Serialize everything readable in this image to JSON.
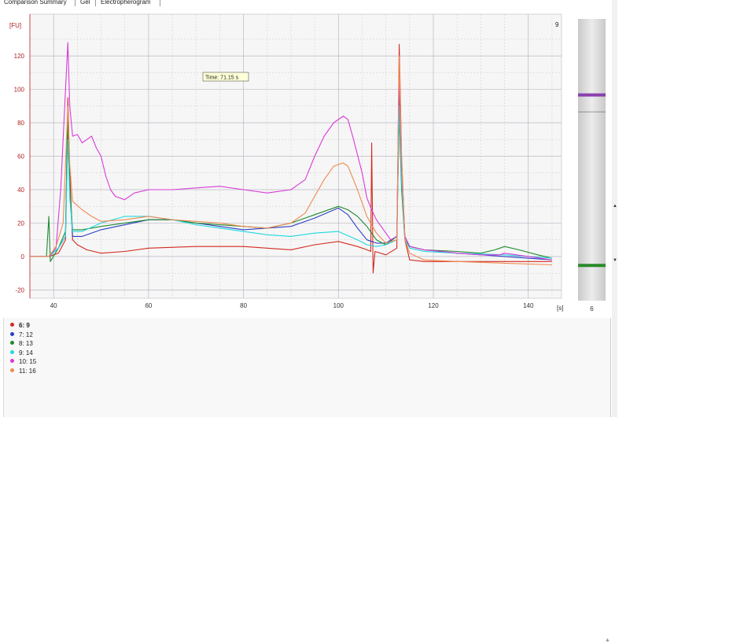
{
  "tabs": [
    "Comparison Summary",
    "Gel",
    "Electropherogram"
  ],
  "chart": {
    "y_unit": "[FU]",
    "x_unit": "[s]",
    "sample_label": "9",
    "tooltip": "Time: 71.15 s"
  },
  "gel": {
    "bottom_label": "6",
    "bands": [
      {
        "position": 0.27,
        "color": "#8a3fb0"
      },
      {
        "position": 0.875,
        "color": "#2a8a2a"
      }
    ],
    "marker_lines": [
      0.33
    ]
  },
  "legend": [
    {
      "label": "6: 9",
      "color": "#d42a20",
      "selected": true
    },
    {
      "label": "7: 12",
      "color": "#2a3fc4",
      "selected": false
    },
    {
      "label": "8: 13",
      "color": "#1f8a30",
      "selected": false
    },
    {
      "label": "9: 14",
      "color": "#20d8e0",
      "selected": false
    },
    {
      "label": "10: 15",
      "color": "#d83ad8",
      "selected": false
    },
    {
      "label": "11: 16",
      "color": "#ef8a50",
      "selected": false
    }
  ],
  "chart_data": {
    "type": "line",
    "xlabel": "[s]",
    "ylabel": "[FU]",
    "xlim": [
      35,
      147
    ],
    "ylim": [
      -25,
      145
    ],
    "xticks": [
      40,
      60,
      80,
      100,
      120,
      140
    ],
    "yticks": [
      -20,
      0,
      20,
      40,
      60,
      80,
      100,
      120
    ],
    "grid": true,
    "legend": "below",
    "series": [
      {
        "name": "6: 9",
        "color": "#d42a20",
        "points": [
          [
            35,
            0
          ],
          [
            39,
            0
          ],
          [
            41,
            2
          ],
          [
            42.5,
            10
          ],
          [
            43,
            95
          ],
          [
            43.4,
            50
          ],
          [
            44,
            10
          ],
          [
            45,
            7
          ],
          [
            47,
            4
          ],
          [
            50,
            2
          ],
          [
            55,
            3
          ],
          [
            60,
            5
          ],
          [
            70,
            6
          ],
          [
            80,
            6
          ],
          [
            85,
            5
          ],
          [
            90,
            4
          ],
          [
            95,
            7
          ],
          [
            100,
            9
          ],
          [
            104,
            6
          ],
          [
            106,
            4
          ],
          [
            106.8,
            3
          ],
          [
            107,
            68
          ],
          [
            107.3,
            -10
          ],
          [
            107.7,
            3
          ],
          [
            110,
            1
          ],
          [
            112.3,
            5
          ],
          [
            112.8,
            127
          ],
          [
            113.3,
            60
          ],
          [
            114,
            10
          ],
          [
            115,
            -2
          ],
          [
            118,
            -3
          ],
          [
            125,
            -3
          ],
          [
            135,
            -3
          ],
          [
            145,
            -3
          ]
        ]
      },
      {
        "name": "7: 12",
        "color": "#2a3fc4",
        "points": [
          [
            35,
            0
          ],
          [
            39,
            0
          ],
          [
            41,
            5
          ],
          [
            42.5,
            12
          ],
          [
            43,
            80
          ],
          [
            43.4,
            40
          ],
          [
            44,
            12
          ],
          [
            46,
            12
          ],
          [
            50,
            16
          ],
          [
            55,
            19
          ],
          [
            60,
            22
          ],
          [
            65,
            22
          ],
          [
            70,
            20
          ],
          [
            75,
            18
          ],
          [
            80,
            16
          ],
          [
            85,
            17
          ],
          [
            90,
            18
          ],
          [
            95,
            23
          ],
          [
            100,
            29
          ],
          [
            102,
            25
          ],
          [
            104,
            17
          ],
          [
            106,
            10
          ],
          [
            108,
            8
          ],
          [
            110,
            8
          ],
          [
            112.3,
            12
          ],
          [
            112.8,
            100
          ],
          [
            113.3,
            50
          ],
          [
            114,
            12
          ],
          [
            115,
            6
          ],
          [
            118,
            4
          ],
          [
            125,
            2
          ],
          [
            135,
            0
          ],
          [
            145,
            -2
          ]
        ]
      },
      {
        "name": "8: 13",
        "color": "#1f8a30",
        "points": [
          [
            35,
            0
          ],
          [
            38.5,
            0
          ],
          [
            39,
            24
          ],
          [
            39.3,
            -3
          ],
          [
            41,
            5
          ],
          [
            42.5,
            15
          ],
          [
            43,
            85
          ],
          [
            43.4,
            40
          ],
          [
            44,
            16
          ],
          [
            46,
            16
          ],
          [
            50,
            18
          ],
          [
            55,
            20
          ],
          [
            60,
            22
          ],
          [
            65,
            22
          ],
          [
            70,
            20
          ],
          [
            75,
            19
          ],
          [
            80,
            18
          ],
          [
            85,
            17
          ],
          [
            90,
            20
          ],
          [
            95,
            25
          ],
          [
            100,
            30
          ],
          [
            102,
            28
          ],
          [
            104,
            24
          ],
          [
            106,
            18
          ],
          [
            108,
            10
          ],
          [
            110,
            7
          ],
          [
            112.3,
            12
          ],
          [
            112.8,
            85
          ],
          [
            113.3,
            40
          ],
          [
            114,
            10
          ],
          [
            115,
            6
          ],
          [
            118,
            4
          ],
          [
            125,
            3
          ],
          [
            130,
            2
          ],
          [
            133,
            4
          ],
          [
            135,
            6
          ],
          [
            138,
            4
          ],
          [
            142,
            1
          ],
          [
            145,
            -1
          ]
        ]
      },
      {
        "name": "9: 14",
        "color": "#20d8e0",
        "points": [
          [
            35,
            0
          ],
          [
            39,
            0
          ],
          [
            41,
            5
          ],
          [
            42.5,
            12
          ],
          [
            43,
            70
          ],
          [
            43.4,
            35
          ],
          [
            44,
            15
          ],
          [
            46,
            15
          ],
          [
            50,
            20
          ],
          [
            55,
            24
          ],
          [
            60,
            24
          ],
          [
            65,
            22
          ],
          [
            70,
            19
          ],
          [
            75,
            17
          ],
          [
            80,
            15
          ],
          [
            85,
            13
          ],
          [
            90,
            12
          ],
          [
            95,
            14
          ],
          [
            100,
            15
          ],
          [
            104,
            10
          ],
          [
            106,
            7
          ],
          [
            108,
            6
          ],
          [
            110,
            7
          ],
          [
            112.3,
            10
          ],
          [
            112.8,
            90
          ],
          [
            113.3,
            45
          ],
          [
            114,
            10
          ],
          [
            115,
            5
          ],
          [
            118,
            3
          ],
          [
            125,
            2
          ],
          [
            135,
            1
          ],
          [
            145,
            -1
          ]
        ]
      },
      {
        "name": "10: 15",
        "color": "#d83ad8",
        "points": [
          [
            35,
            0
          ],
          [
            39,
            0
          ],
          [
            40.5,
            5
          ],
          [
            41.5,
            40
          ],
          [
            42.5,
            100
          ],
          [
            43,
            128
          ],
          [
            43.4,
            90
          ],
          [
            44,
            72
          ],
          [
            45,
            73
          ],
          [
            46,
            68
          ],
          [
            47,
            70
          ],
          [
            48,
            72
          ],
          [
            49,
            65
          ],
          [
            50,
            60
          ],
          [
            51,
            48
          ],
          [
            52,
            40
          ],
          [
            53,
            36
          ],
          [
            55,
            34
          ],
          [
            57,
            38
          ],
          [
            60,
            40
          ],
          [
            65,
            40
          ],
          [
            70,
            41
          ],
          [
            75,
            42
          ],
          [
            80,
            40
          ],
          [
            85,
            38
          ],
          [
            90,
            40
          ],
          [
            93,
            46
          ],
          [
            95,
            60
          ],
          [
            97,
            72
          ],
          [
            99,
            80
          ],
          [
            101,
            84
          ],
          [
            102,
            82
          ],
          [
            103,
            72
          ],
          [
            105,
            50
          ],
          [
            106,
            35
          ],
          [
            107,
            28
          ],
          [
            108,
            22
          ],
          [
            110,
            14
          ],
          [
            111,
            10
          ],
          [
            112.3,
            12
          ],
          [
            112.8,
            110
          ],
          [
            113.3,
            55
          ],
          [
            114,
            12
          ],
          [
            115,
            6
          ],
          [
            118,
            4
          ],
          [
            122,
            3
          ],
          [
            125,
            2
          ],
          [
            130,
            1
          ],
          [
            134,
            1
          ],
          [
            135,
            2
          ],
          [
            140,
            0
          ],
          [
            145,
            -2
          ]
        ]
      },
      {
        "name": "11: 16",
        "color": "#ef8a50",
        "points": [
          [
            35,
            0
          ],
          [
            39,
            0
          ],
          [
            40.5,
            6
          ],
          [
            42,
            20
          ],
          [
            43,
            90
          ],
          [
            43.4,
            55
          ],
          [
            44,
            33
          ],
          [
            46,
            28
          ],
          [
            48,
            24
          ],
          [
            50,
            21
          ],
          [
            55,
            22
          ],
          [
            60,
            24
          ],
          [
            65,
            22
          ],
          [
            70,
            21
          ],
          [
            75,
            20
          ],
          [
            80,
            18
          ],
          [
            85,
            17
          ],
          [
            90,
            20
          ],
          [
            93,
            26
          ],
          [
            95,
            36
          ],
          [
            97,
            46
          ],
          [
            99,
            54
          ],
          [
            101,
            56
          ],
          [
            102,
            54
          ],
          [
            104,
            40
          ],
          [
            106,
            24
          ],
          [
            108,
            14
          ],
          [
            110,
            8
          ],
          [
            112.3,
            10
          ],
          [
            112.8,
            120
          ],
          [
            113.3,
            60
          ],
          [
            114,
            10
          ],
          [
            115,
            2
          ],
          [
            118,
            -2
          ],
          [
            125,
            -3
          ],
          [
            135,
            -4
          ],
          [
            145,
            -5
          ]
        ]
      }
    ]
  }
}
